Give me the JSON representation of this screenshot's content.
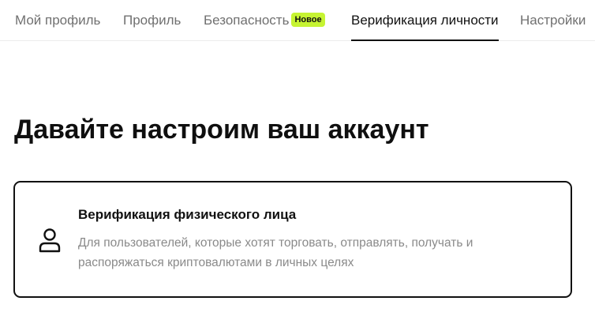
{
  "tabs": [
    {
      "label": "Мой профиль",
      "active": false
    },
    {
      "label": "Профиль",
      "active": false
    },
    {
      "label": "Безопасность",
      "active": false,
      "badge": "Новое"
    },
    {
      "label": "Верификация личности",
      "active": true
    },
    {
      "label": "Настройки",
      "active": false
    }
  ],
  "page": {
    "title": "Давайте настроим ваш аккаунт"
  },
  "card": {
    "icon": "user-icon",
    "title": "Верификация физического лица",
    "description": "Для пользователей, которые хотят торговать, отправлять, получать и распоряжаться криптовалютами в личных целях"
  },
  "colors": {
    "badge_bg": "#c6f432",
    "text_primary": "#111111",
    "text_muted": "#8a8a8a"
  }
}
